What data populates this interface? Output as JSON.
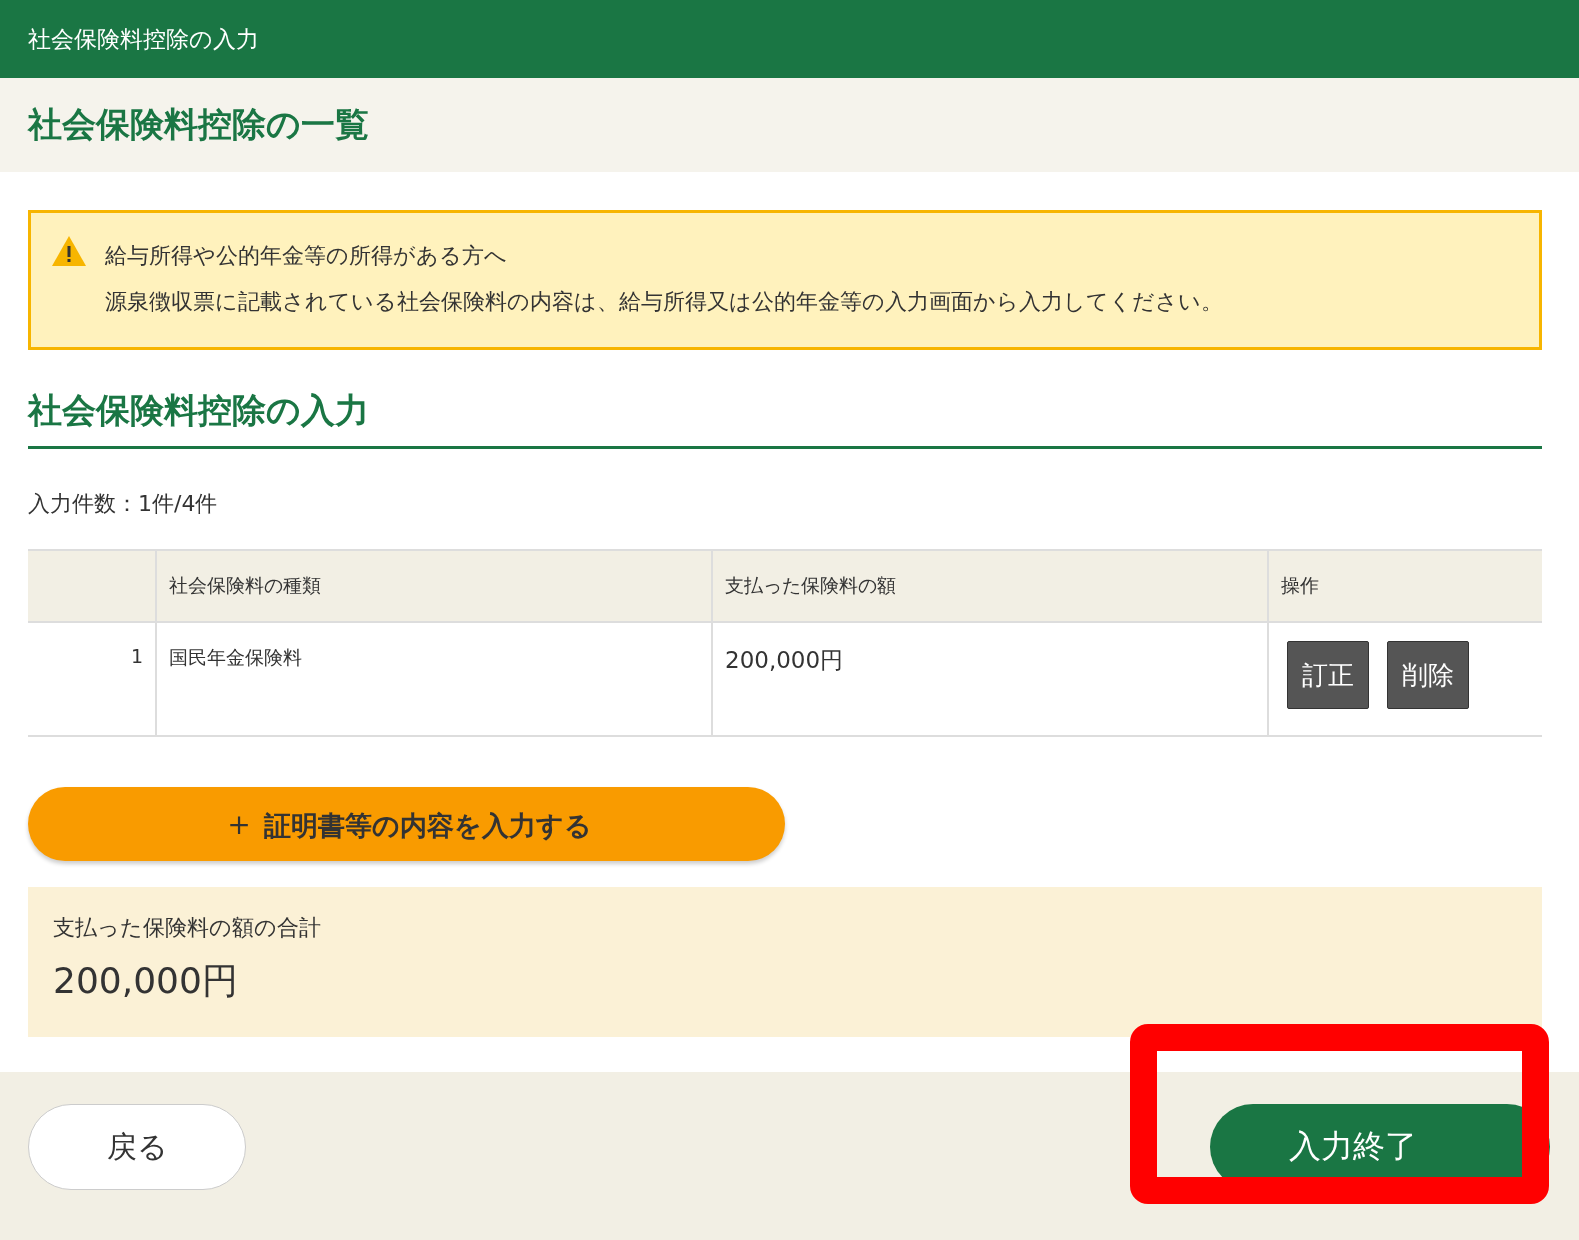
{
  "header": {
    "title": "社会保険料控除の入力"
  },
  "page_title": "社会保険料控除の一覧",
  "alert": {
    "lines": [
      "給与所得や公的年金等の所得がある方へ",
      "源泉徴収票に記載されている社会保険料の内容は、給与所得又は公的年金等の入力画面から入力してください。"
    ]
  },
  "section_title": "社会保険料控除の入力",
  "count": "入力件数：1件/4件",
  "table": {
    "columns": [
      "社会保険料の種類",
      "支払った保険料の額",
      "操作"
    ],
    "rows": [
      {
        "number": "1",
        "type": "国民年金保険料",
        "amount": "200,000円",
        "actions": [
          "訂正",
          "削除"
        ]
      }
    ]
  },
  "add_button": {
    "icon": "＋",
    "label": "証明書等の内容を入力する"
  },
  "total": {
    "label": "支払った保険料の額の合計",
    "value": "200,000円"
  },
  "footer": {
    "back": "戻る",
    "finish": "入力終了"
  }
}
